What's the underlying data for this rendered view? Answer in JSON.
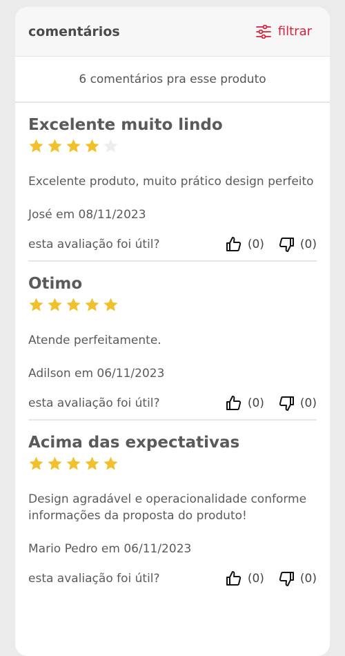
{
  "header": {
    "title": "comentários",
    "filter_label": "filtrar",
    "filter_icon": "sliders-icon",
    "accent_color": "#d7213a"
  },
  "summary": {
    "count_text": "6 comentários pra esse produto"
  },
  "helpful_label": "esta avaliação foi útil?",
  "star_color": "#f0c12c",
  "star_empty_color": "#ededed",
  "reviews": [
    {
      "title": "Excelente muito lindo",
      "rating": 4,
      "text": "Excelente produto,  muito prático design perfeito",
      "author": "José em 08/11/2023",
      "likes": "(0)",
      "dislikes": "(0)"
    },
    {
      "title": "Otimo",
      "rating": 5,
      "text": "Atende perfeitamente.",
      "author": "Adilson em 06/11/2023",
      "likes": "(0)",
      "dislikes": "(0)"
    },
    {
      "title": "Acima das expectativas",
      "rating": 5,
      "text": "Design agradável e operacionalidade conforme informações da proposta do produto!",
      "author": "Mario Pedro em 06/11/2023",
      "likes": "(0)",
      "dislikes": "(0)"
    }
  ]
}
